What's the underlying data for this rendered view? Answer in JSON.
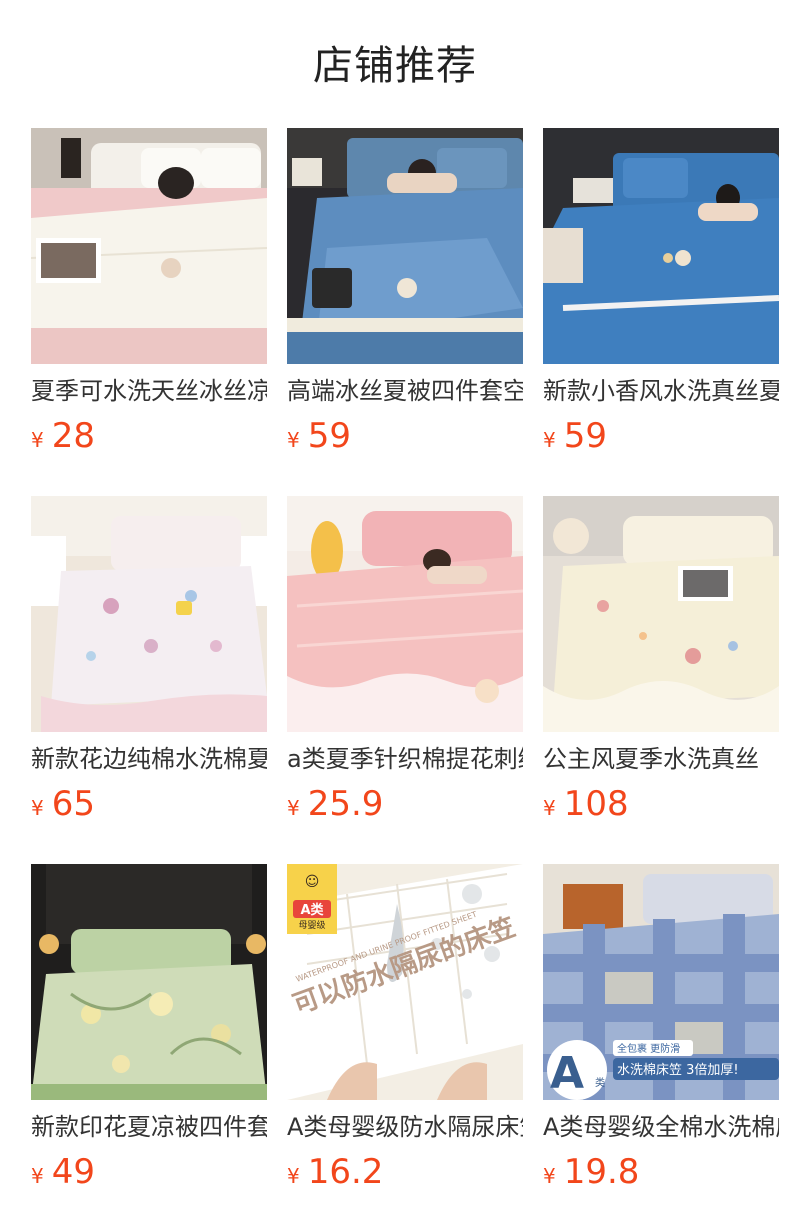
{
  "section": {
    "title": "店铺推荐"
  },
  "currency_symbol": "¥",
  "products": [
    {
      "title": "夏季可水洗天丝冰丝凉被四件套",
      "price": "28",
      "image": "white-silk-quilt-bed-photo"
    },
    {
      "title": "高端冰丝夏被四件套空调被",
      "price": "59",
      "image": "blue-silk-quilt-bed-photo"
    },
    {
      "title": "新款小香风水洗真丝夏凉被",
      "price": "59",
      "image": "blue-embroidered-quilt-bed-photo"
    },
    {
      "title": "新款花边纯棉水洗棉夏凉被",
      "price": "65",
      "image": "floral-lace-quilt-bed-photo"
    },
    {
      "title": "a类夏季针织棉提花刺绣凉被",
      "price": "25.9",
      "image": "pink-ruffle-quilt-bed-photo"
    },
    {
      "title": "公主风夏季水洗真丝",
      "price": "108",
      "image": "cream-ruffle-quilt-bed-photo"
    },
    {
      "title": "新款印花夏凉被四件套",
      "price": "49",
      "image": "green-floral-quilt-bed-photo"
    },
    {
      "title": "A类母婴级防水隔尿床笠",
      "price": "16.2",
      "image": "white-waterproof-fitted-sheet-photo",
      "overlay": {
        "badge": "A类",
        "badge_sub": "母婴级",
        "banner": "可以防水隔尿的床笠",
        "banner_en": "WATERPROOF AND URINE PROOF FITTED SHEET"
      }
    },
    {
      "title": "A类母婴级全棉水洗棉床笠",
      "price": "19.8",
      "image": "blue-plaid-fitted-sheet-photo",
      "overlay": {
        "badge": "A",
        "badge_sub": "类",
        "tag_small": "全包裹 更防滑",
        "tag_main": "水洗棉床笠 3倍加厚!"
      }
    }
  ]
}
